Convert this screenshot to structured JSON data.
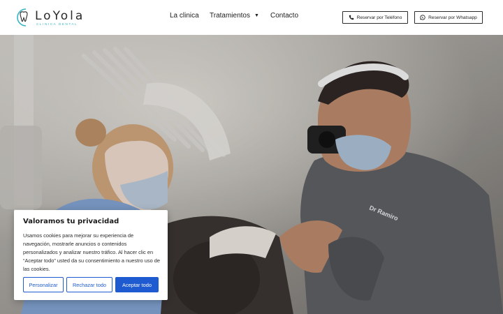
{
  "header": {
    "logo_name": "LoYola",
    "logo_sub": "CLINICA DENTAL",
    "nav": [
      {
        "label": "La clinica"
      },
      {
        "label": "Tratamientos"
      },
      {
        "label": "Contacto"
      }
    ],
    "phone_button": "Reservar por Teléfono",
    "whatsapp_button": "Reservar por Whatsapp"
  },
  "hero": {
    "coat_label": "Dr Ramiro"
  },
  "cookie": {
    "title": "Valoramos tu privacidad",
    "text": "Usamos cookies para mejorar su experiencia de navegación, mostrarle anuncios o contenidos personalizados y analizar nuestro tráfico. Al hacer clic en “Aceptar todo” usted da su consentimiento a nuestro uso de las cookies.",
    "customize": "Personalizar",
    "reject": "Rechazar todo",
    "accept": "Aceptar todo"
  },
  "colors": {
    "accent": "#1e5bd1",
    "logo_teal": "#33b6c5"
  }
}
